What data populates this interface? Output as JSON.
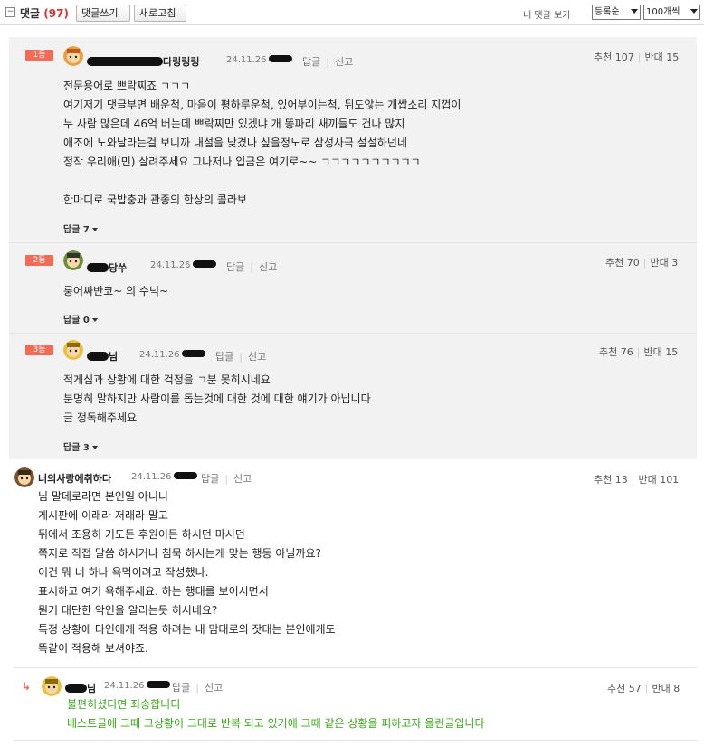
{
  "toolbar": {
    "collapse_icon": "minus-box-icon",
    "title": "댓글",
    "count": "(97)",
    "write_label": "댓글쓰기",
    "refresh_label": "새로고침",
    "my_comments_label": "내 댓글 보기",
    "sort_value": "등록순",
    "per_page_value": "100개씩"
  },
  "best": [
    {
      "rank": "1등",
      "nick_suffix": "다링링링",
      "date": "24.11.26",
      "reply_label": "답글",
      "report_label": "신고",
      "votes_up": "추천 107",
      "votes_down": "반대 15",
      "lines": "전문용어로 쁘락찌죠 ㄱㄱㄱ\n여기저기 댓글부면 배운척, 마음이 평하루운척, 있어부이는척, 뒤도않는 개쌉소리 지껍이\n누 사람 많은데 46억 버는데 쁘락찌만 있겠냐 개 똥파리 새끼들도 건나 많지\n애조에 노와날라는걸 보니까 내설을 낮겼나 싶을정노로 삼성사극 설설하넌네\n정작 우리애(민) 살려주세요 그나저나 입금은 여기로~~ ㄱㄱㄱㄱㄱㄱㄱㄱㄱㄱ\n\n한마디로 국밥충과 관종의 한상의 콜라보",
      "replies": "답글 7"
    },
    {
      "rank": "2등",
      "nick_suffix": "당쑤",
      "date": "24.11.26",
      "reply_label": "답글",
      "report_label": "신고",
      "votes_up": "추천 70",
      "votes_down": "반대 3",
      "lines": "룽어싸반코~ 의 수넉~",
      "replies": "답글 0"
    },
    {
      "rank": "3등",
      "nick_suffix": "님",
      "date": "24.11.26",
      "reply_label": "답글",
      "report_label": "신고",
      "votes_up": "추천 76",
      "votes_down": "반대 15",
      "lines": "적게심과 상황에 대한 걱정을 ㄱ분 못히시네요\n분명히 말하지만 사람이를 돕는것에 대한 것에 대한 얘기가 아닙니다\n글 정독해주세요",
      "replies": "답글 3"
    }
  ],
  "comments": [
    {
      "nick": "너의사랑에취하다",
      "date": "24.11.26",
      "reply_label": "답글",
      "report_label": "신고",
      "votes_up": "추천 13",
      "votes_down": "반대 101",
      "lines": "님 말데로라면 본인일 아니니\n게시판에 이래라 저래라 말고\n뒤에서 조용히 기도든 후원이든 하시던 마시던\n쪽지로 직접 말씀 하시거나 침묵 하시는게 맞는 행동 아닐까요?\n이건 뭐 너 하나 욕먹이려고 작성했나.\n표시하고 여기 욕해주세요. 하는 행태를 보이시면서\n뭔기 대단한 악인을 알리는듯 히시네요?\n특정 상황에 타인에게 적용 하려는 내 맘대로의 잣대는 본인에게도\n똑같이 적용해 보셔야죠."
    },
    {
      "nick_suffix": "님",
      "date": "24.11.26",
      "reply_label": "답글",
      "report_label": "신고",
      "votes_up": "추천 57",
      "votes_down": "반대 8",
      "lines": "불편히셨디면 죄송합니디\n베스트글에 그때 그상황이 그대로 반복 되고 있기에 그때 같은 상황을 피하고자 올린글입니다"
    }
  ]
}
